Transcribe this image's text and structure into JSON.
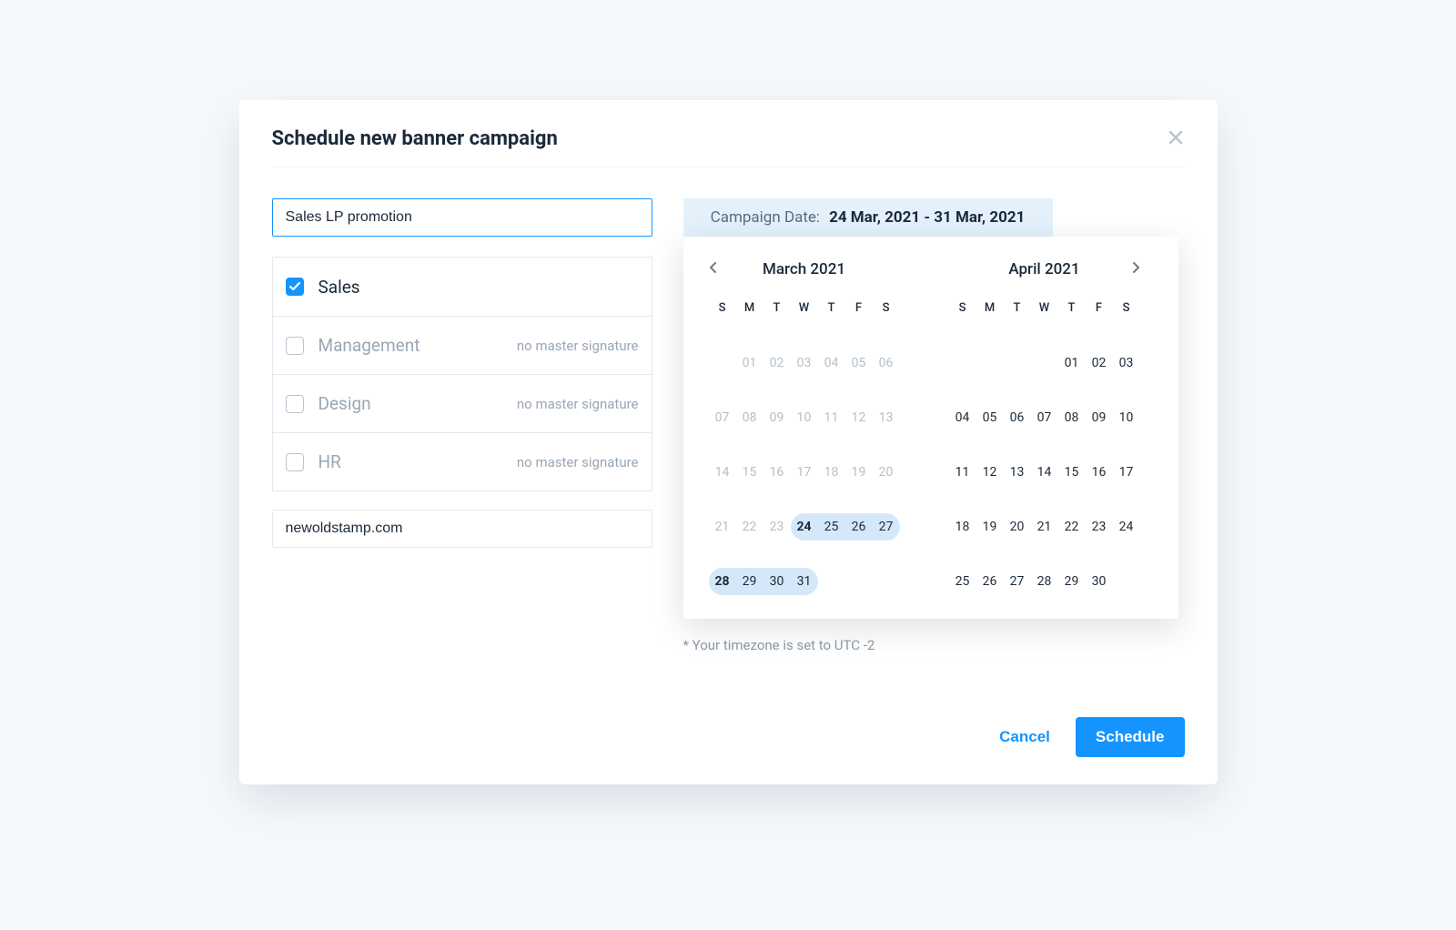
{
  "modal": {
    "title": "Schedule new banner campaign",
    "campaign_name": "Sales LP promotion",
    "url_value": "newoldstamp.com",
    "departments": [
      {
        "label": "Sales",
        "checked": true,
        "note": ""
      },
      {
        "label": "Management",
        "checked": false,
        "note": "no master signature"
      },
      {
        "label": "Design",
        "checked": false,
        "note": "no master signature"
      },
      {
        "label": "HR",
        "checked": false,
        "note": "no master signature"
      }
    ],
    "date_header": {
      "label": "Campaign Date:",
      "value": "24 Mar, 2021 - 31 Mar, 2021"
    },
    "calendars": {
      "dow": [
        "S",
        "M",
        "T",
        "W",
        "T",
        "F",
        "S"
      ],
      "left": {
        "title": "March 2021",
        "lead_blanks": 1,
        "days": [
          {
            "n": "01",
            "muted": true
          },
          {
            "n": "02",
            "muted": true
          },
          {
            "n": "03",
            "muted": true
          },
          {
            "n": "04",
            "muted": true
          },
          {
            "n": "05",
            "muted": true
          },
          {
            "n": "06",
            "muted": true
          },
          {
            "n": "07",
            "muted": true
          },
          {
            "n": "08",
            "muted": true
          },
          {
            "n": "09",
            "muted": true
          },
          {
            "n": "10",
            "muted": true
          },
          {
            "n": "11",
            "muted": true
          },
          {
            "n": "12",
            "muted": true
          },
          {
            "n": "13",
            "muted": true
          },
          {
            "n": "14",
            "muted": true
          },
          {
            "n": "15",
            "muted": true
          },
          {
            "n": "16",
            "muted": true
          },
          {
            "n": "17",
            "muted": true
          },
          {
            "n": "18",
            "muted": true
          },
          {
            "n": "19",
            "muted": true
          },
          {
            "n": "20",
            "muted": true
          },
          {
            "n": "21",
            "muted": true
          },
          {
            "n": "22",
            "muted": true
          },
          {
            "n": "23",
            "muted": true
          },
          {
            "n": "24",
            "sel": "start"
          },
          {
            "n": "25",
            "sel": "mid"
          },
          {
            "n": "26",
            "sel": "mid"
          },
          {
            "n": "27",
            "sel": "end"
          },
          {
            "n": "28",
            "sel": "start"
          },
          {
            "n": "29",
            "sel": "mid"
          },
          {
            "n": "30",
            "sel": "mid"
          },
          {
            "n": "31",
            "sel": "end"
          }
        ]
      },
      "right": {
        "title": "April 2021",
        "lead_blanks": 4,
        "days": [
          {
            "n": "01"
          },
          {
            "n": "02"
          },
          {
            "n": "03"
          },
          {
            "n": "04"
          },
          {
            "n": "05"
          },
          {
            "n": "06"
          },
          {
            "n": "07"
          },
          {
            "n": "08"
          },
          {
            "n": "09"
          },
          {
            "n": "10"
          },
          {
            "n": "11"
          },
          {
            "n": "12"
          },
          {
            "n": "13"
          },
          {
            "n": "14"
          },
          {
            "n": "15"
          },
          {
            "n": "16"
          },
          {
            "n": "17"
          },
          {
            "n": "18"
          },
          {
            "n": "19"
          },
          {
            "n": "20"
          },
          {
            "n": "21"
          },
          {
            "n": "22"
          },
          {
            "n": "23"
          },
          {
            "n": "24"
          },
          {
            "n": "25"
          },
          {
            "n": "26"
          },
          {
            "n": "27"
          },
          {
            "n": "28"
          },
          {
            "n": "29"
          },
          {
            "n": "30"
          }
        ]
      }
    },
    "timezone_note": "* Your timezone is set to UTC -2",
    "buttons": {
      "cancel": "Cancel",
      "schedule": "Schedule"
    }
  }
}
